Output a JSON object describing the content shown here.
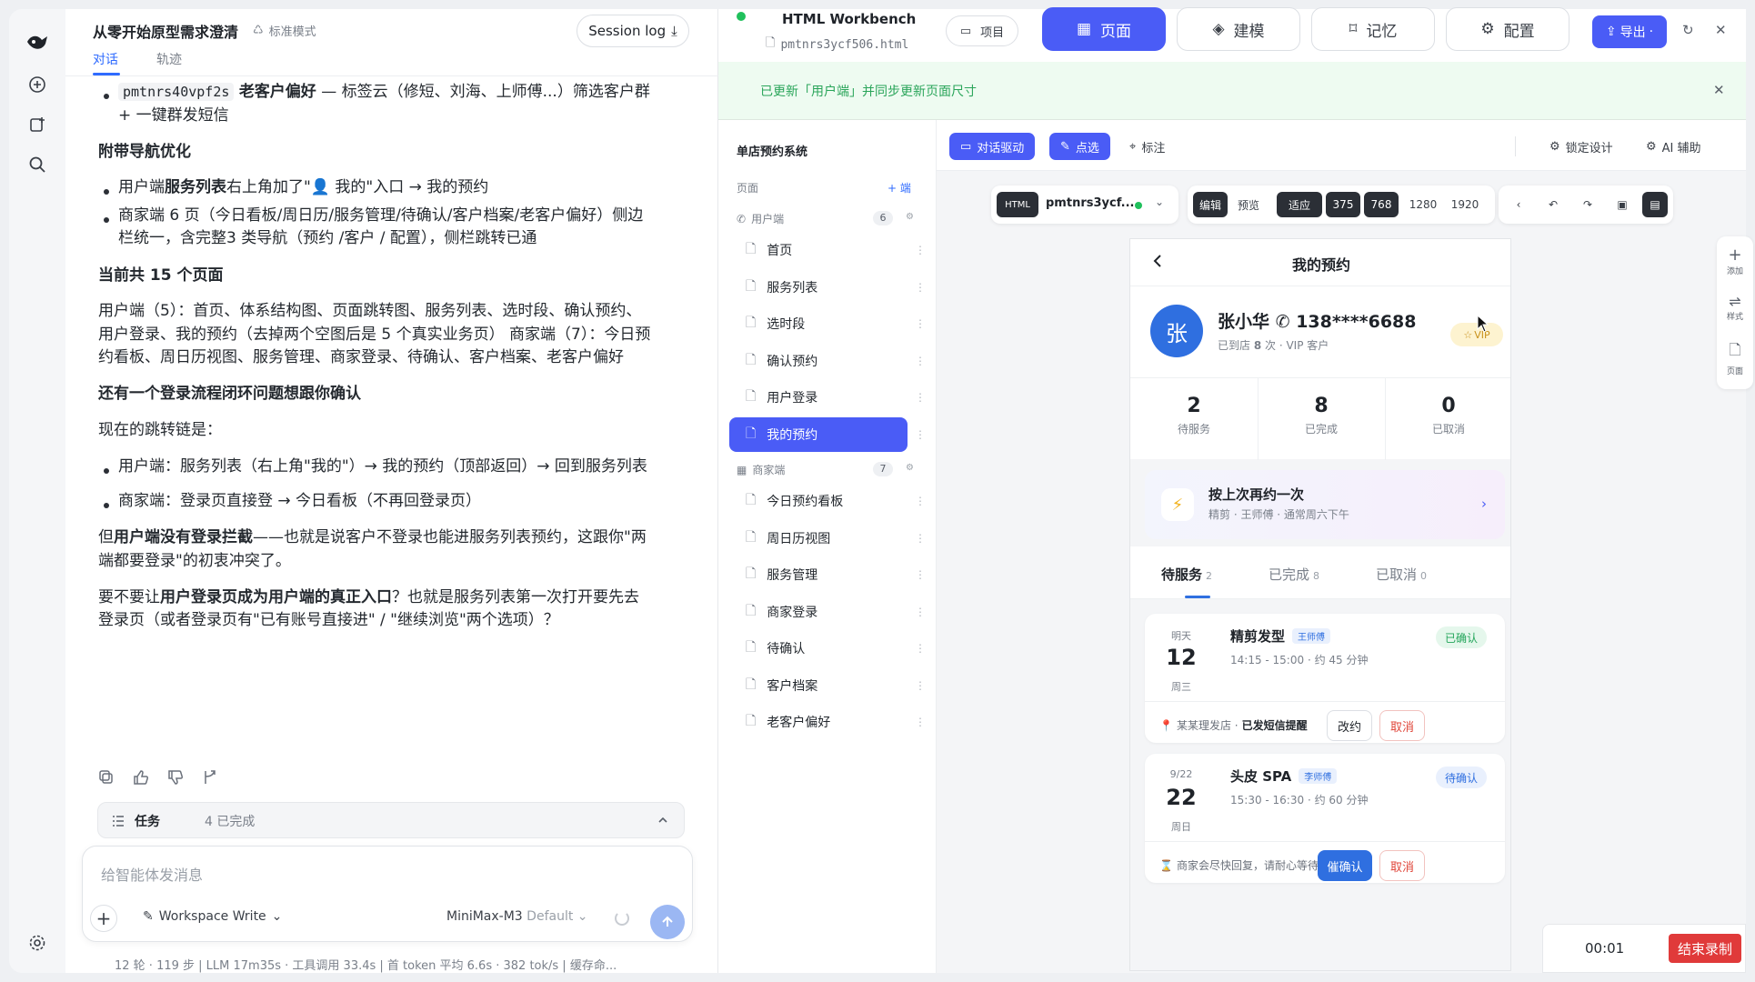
{
  "chat": {
    "title": "从零开始原型需求澄清",
    "mode": "标准模式",
    "session_log": "Session log",
    "tabs": [
      "对话",
      "轨迹"
    ],
    "lines": {
      "l1_code": "pmtnrs40vpf2s",
      "l1_bold": "老客户偏好",
      "l1_rest": " — 标签云（修短、刘海、上师傅...）筛选客户群",
      "l1_cont": "+ 一键群发短信",
      "h_nav": "附带导航优化",
      "b1_pre": "用户端",
      "b1_bold": "服务列表",
      "b1_rest": "右上角加了\"👤 我的\"入口 → 我的预约",
      "b2_l1": "商家端 6 页（今日看板/周日历/服务管理/待确认/客户档案/老客户偏好）侧边",
      "b2_l2": "栏统一，含完整3 类导航（预约 /客户 / 配置），侧栏跳转已通",
      "h_count": "当前共 15 个页面",
      "p1_l1": "用户端（5）：首页、体系结构图、页面跳转图、服务列表、选时段、确认预约、",
      "p1_l2": "用户登录、我的预约（去掉两个空图后是 5 个真实业务页） 商家端（7）：今日预",
      "p1_l3": "约看板、周日历视图、服务管理、商家登录、待确认、客户档案、老客户偏好",
      "h_login": "还有一个登录流程闭环问题想跟你确认",
      "p2": "现在的跳转链是：",
      "b3": "用户端：服务列表（右上角\"我的\"）→ 我的预约（顶部返回）→ 回到服务列表",
      "b4": "商家端：登录页直接登 → 今日看板（不再回登录页）",
      "p3_pre": "但",
      "p3_bold": "用户端没有登录拦截",
      "p3_rest": "——也就是说客户不登录也能进服务列表预约，这跟你\"两",
      "p3_l2": "端都要登录\"的初衷冲突了。",
      "p4_pre": "要不要让",
      "p4_bold": "用户登录页成为用户端的真正入口",
      "p4_rest": "？也就是服务列表第一次打开要先去",
      "p4_l2": "登录页（或者登录页有\"已有账号直接进\" / \"继续浏览\"两个选项）？"
    },
    "task": {
      "label": "任务",
      "count": "4 已完成"
    },
    "composer": {
      "placeholder": "给智能体发消息",
      "workspace": "Workspace Write",
      "model": "MiniMax-M3",
      "model_default": "Default"
    },
    "stats": "12 轮 · 119 步   |   LLM 17m35s · 工具调用 33.4s   |   首 token 平均 6.6s · 382 tok/s   |   缓存命..."
  },
  "workbench": {
    "title": "HTML Workbench",
    "file": "pmtnrs3ycf506.html",
    "project_btn": "项目",
    "tabs": [
      "页面",
      "建模",
      "记忆",
      "配置"
    ],
    "export": "导出",
    "banner": "已更新「用户端」并同步更新页面尺寸"
  },
  "pages": {
    "project_name": "单店预约系统",
    "section_label": "页面",
    "add_end": "+ 端",
    "user_group": {
      "label": "用户端",
      "count": "6"
    },
    "user_pages": [
      "首页",
      "服务列表",
      "选时段",
      "确认预约",
      "用户登录",
      "我的预约"
    ],
    "merchant_group": {
      "label": "商家端",
      "count": "7"
    },
    "merchant_pages": [
      "今日预约看板",
      "周日历视图",
      "服务管理",
      "商家登录",
      "待确认",
      "客户档案",
      "老客户偏好"
    ]
  },
  "design": {
    "chat_drive": "对话驱动",
    "pick": "点选",
    "annotate": "标注",
    "lock": "锁定设计",
    "ai_assist": "AI 辅助",
    "html_tag": "HTML",
    "file_short": "pmtnrs3ycf...",
    "edit": "编辑",
    "preview": "预览",
    "fit": "适应",
    "sizes": [
      "375",
      "768",
      "1280",
      "1920"
    ],
    "side_tools": [
      "添加",
      "样式",
      "页面"
    ]
  },
  "phone": {
    "title": "我的预约",
    "avatar": "张",
    "name": "张小华",
    "phone": "138****6688",
    "sub_pre": "已到店 ",
    "sub_num": "8",
    "sub_rest": " 次 · VIP 客户",
    "vip": "VIP",
    "stats": [
      {
        "n": "2",
        "l": "待服务"
      },
      {
        "n": "8",
        "l": "已完成"
      },
      {
        "n": "0",
        "l": "已取消"
      }
    ],
    "rebook_title": "按上次再约一次",
    "rebook_sub": "精剪 · 王师傅 · 通常周六下午",
    "tabs": [
      {
        "label": "待服务",
        "count": "2"
      },
      {
        "label": "已完成",
        "count": "8"
      },
      {
        "label": "已取消",
        "count": "0"
      }
    ],
    "appts": [
      {
        "day": "明天",
        "date": "12",
        "week": "周三",
        "service": "精剪发型",
        "tech": "王师傅",
        "time": "14:15 - 15:00 · 约 45 分钟",
        "status": "已确认",
        "foot_pre": "某某理发店 · ",
        "foot_bold": "已发短信提醒",
        "btn1": "改约",
        "btn2": "取消"
      },
      {
        "day": "9/22",
        "date": "22",
        "week": "周日",
        "service": "头皮 SPA",
        "tech": "李师傅",
        "time": "15:30 - 16:30 · 约 60 分钟",
        "status": "待确认",
        "foot": "商家会尽快回复，请耐心等待",
        "btn1": "催确认",
        "btn2": "取消"
      }
    ]
  },
  "recording": {
    "time": "00:01",
    "stop": "结束录制"
  }
}
